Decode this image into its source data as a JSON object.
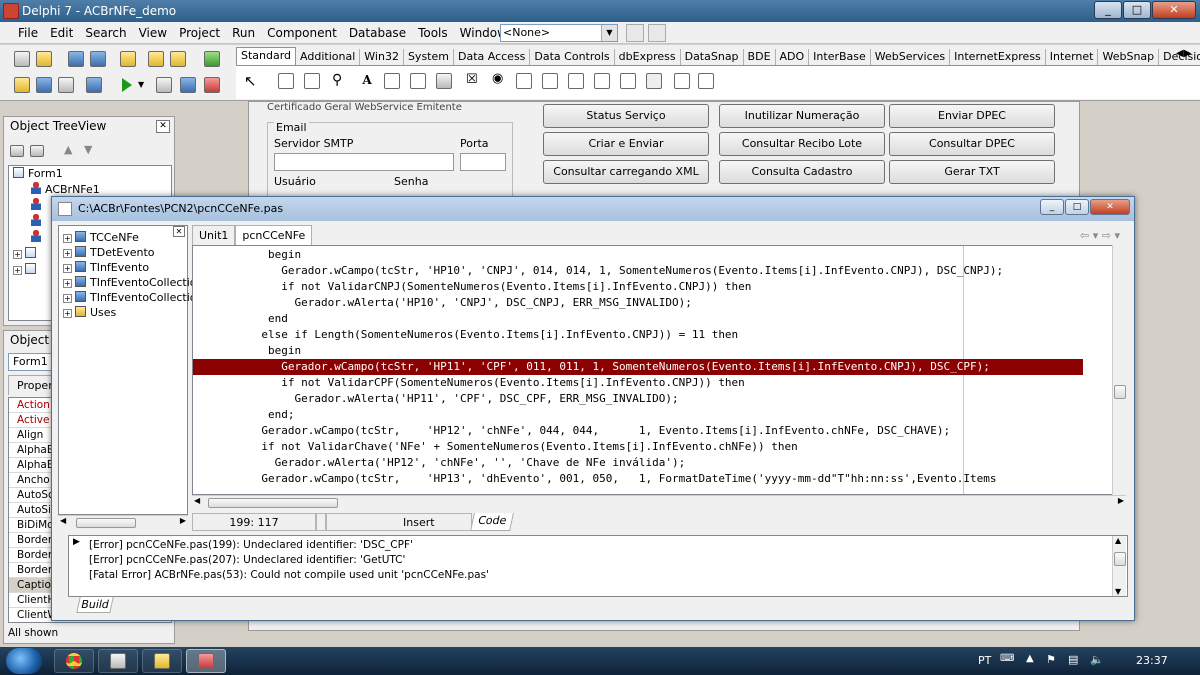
{
  "app": {
    "title": "Delphi 7 - ACBrNFe_demo",
    "win_min": "_",
    "win_max": "□",
    "win_close": "✕"
  },
  "menu": [
    "File",
    "Edit",
    "Search",
    "View",
    "Project",
    "Run",
    "Component",
    "Database",
    "Tools",
    "Window",
    "Help"
  ],
  "desktop_combo": {
    "value": "<None>"
  },
  "palette": {
    "tabs": [
      "Standard",
      "Additional",
      "Win32",
      "System",
      "Data Access",
      "Data Controls",
      "dbExpress",
      "DataSnap",
      "BDE",
      "ADO",
      "InterBase",
      "WebServices",
      "InternetExpress",
      "Internet",
      "WebSnap",
      "Decision Cube",
      "Dialo..."
    ]
  },
  "tree": {
    "title": "Object TreeView",
    "items": [
      "Form1",
      "ACBrNFe1"
    ]
  },
  "inspector": {
    "title": "Object In",
    "combo": "Form1",
    "tab": "Properti",
    "rows": [
      "Action",
      "Active",
      "Align",
      "AlphaB",
      "AlphaB",
      "Ancho",
      "AutoSc",
      "AutoSi",
      "BiDiMo",
      "Border",
      "Border",
      "Border",
      "Captio",
      "ClientH",
      "ClientW"
    ],
    "status": "All shown"
  },
  "form": {
    "tabs": "Certificado   Geral   WebService   Emitente",
    "email_label": "Email",
    "smtp_label": "Servidor SMTP",
    "port_label": "Porta",
    "user_label": "Usuário",
    "pass_label": "Senha",
    "buttons": [
      [
        "Status Serviço",
        "Inutilizar Numeração",
        "Enviar DPEC"
      ],
      [
        "Criar e Enviar",
        "Consultar Recibo Lote",
        "Consultar DPEC"
      ],
      [
        "Consultar carregando XML",
        "Consulta Cadastro",
        "Gerar TXT"
      ]
    ]
  },
  "editor": {
    "title": "C:\\ACBr\\Fontes\\PCN2\\pcnCCeNFe.pas",
    "tabs": [
      "Unit1",
      "pcnCCeNFe"
    ],
    "explorer": [
      "TCCeNFe",
      "TDetEvento",
      "TInfEvento",
      "TInfEventoCollection",
      "TInfEventoCollectionIt",
      "Uses"
    ],
    "code": [
      {
        "t": "        begin",
        "hl": false
      },
      {
        "t": "          Gerador.wCampo(tcStr, 'HP10', 'CNPJ', 014, 014, 1, SomenteNumeros(Evento.Items[i].InfEvento.CNPJ), DSC_CNPJ);",
        "hl": false
      },
      {
        "t": "          if not ValidarCNPJ(SomenteNumeros(Evento.Items[i].InfEvento.CNPJ)) then",
        "hl": false
      },
      {
        "t": "            Gerador.wAlerta('HP10', 'CNPJ', DSC_CNPJ, ERR_MSG_INVALIDO);",
        "hl": false
      },
      {
        "t": "        end",
        "hl": false
      },
      {
        "t": "       else if Length(SomenteNumeros(Evento.Items[i].InfEvento.CNPJ)) = 11 then",
        "hl": false
      },
      {
        "t": "        begin",
        "hl": false
      },
      {
        "t": "          Gerador.wCampo(tcStr, 'HP11', 'CPF', 011, 011, 1, SomenteNumeros(Evento.Items[i].InfEvento.CNPJ), DSC_CPF);",
        "hl": true
      },
      {
        "t": "          if not ValidarCPF(SomenteNumeros(Evento.Items[i].InfEvento.CNPJ)) then",
        "hl": false
      },
      {
        "t": "            Gerador.wAlerta('HP11', 'CPF', DSC_CPF, ERR_MSG_INVALIDO);",
        "hl": false
      },
      {
        "t": "        end;",
        "hl": false
      },
      {
        "t": "       Gerador.wCampo(tcStr,    'HP12', 'chNFe', 044, 044,      1, Evento.Items[i].InfEvento.chNFe, DSC_CHAVE);",
        "hl": false
      },
      {
        "t": "       if not ValidarChave('NFe' + SomenteNumeros(Evento.Items[i].InfEvento.chNFe)) then",
        "hl": false
      },
      {
        "t": "         Gerador.wAlerta('HP12', 'chNFe', '', 'Chave de NFe inválida');",
        "hl": false
      },
      {
        "t": "       Gerador.wCampo(tcStr,    'HP13', 'dhEvento', 001, 050,   1, FormatDateTime('yyyy-mm-dd\"T\"hh:nn:ss',Evento.Items",
        "hl": false
      }
    ],
    "status": {
      "pos": "199: 117",
      "mode": "Insert",
      "tab": "Code"
    },
    "messages": [
      "[Error] pcnCCeNFe.pas(199): Undeclared identifier: 'DSC_CPF'",
      "[Error] pcnCCeNFe.pas(207): Undeclared identifier: 'GetUTC'",
      "[Fatal Error] ACBrNFe.pas(53): Could not compile used unit 'pcnCCeNFe.pas'"
    ],
    "msg_tab": "Build"
  },
  "taskbar": {
    "lang": "PT",
    "time": "23:37"
  }
}
